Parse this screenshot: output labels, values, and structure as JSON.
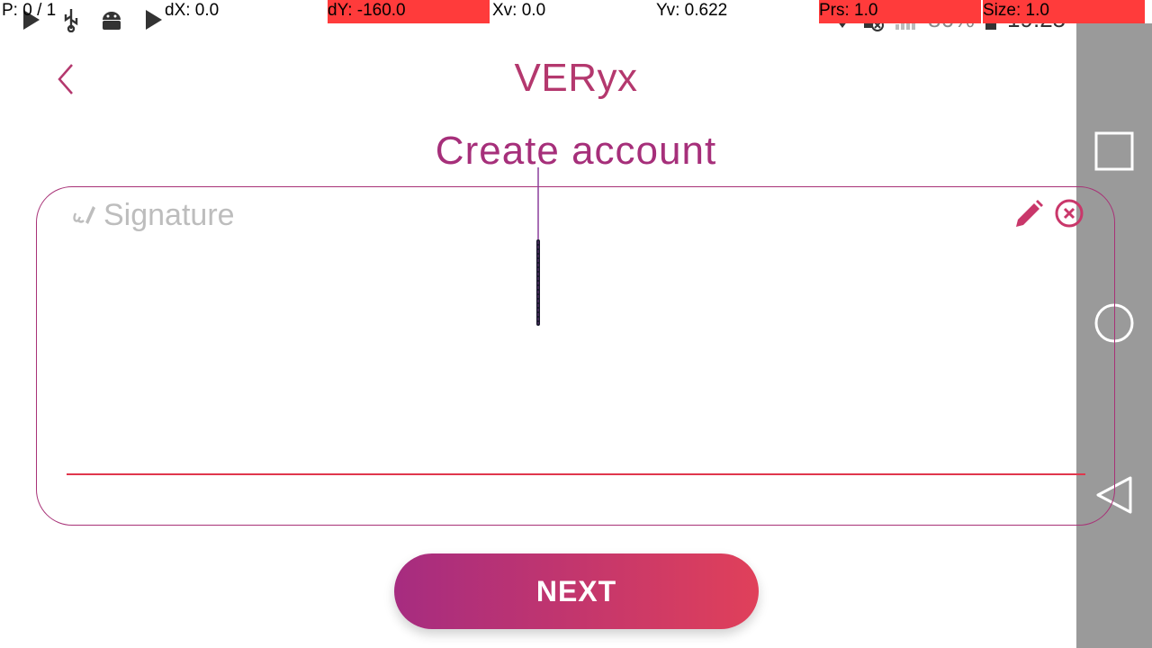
{
  "status_bar": {
    "battery": "86%",
    "time": "19:25"
  },
  "debug_overlay": {
    "pointer": "P: 0 / 1",
    "dx": "dX: 0.0",
    "dy": "dY: -160.0",
    "xv": "Xv: 0.0",
    "yv": "Yv: 0.622",
    "prs": "Prs: 1.0",
    "size": "Size: 1.0"
  },
  "header": {
    "app_title": "VERyx",
    "page_title": "Create account"
  },
  "signature": {
    "label": "Signature"
  },
  "actions": {
    "next_label": "NEXT"
  },
  "colors": {
    "brand_primary": "#a62c80",
    "brand_secondary": "#e0405a",
    "nav_bar": "#9a9a9a"
  }
}
